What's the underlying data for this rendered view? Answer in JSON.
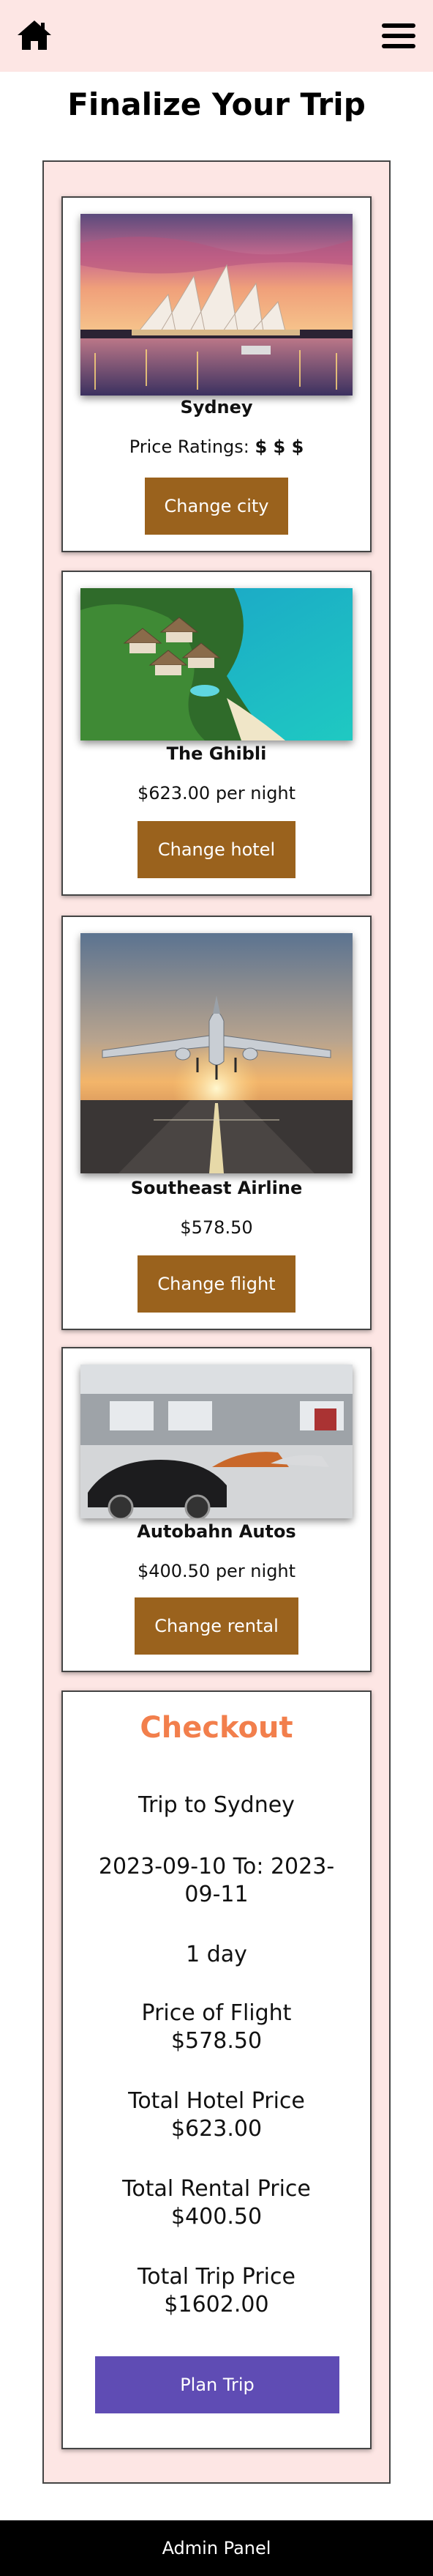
{
  "header": {
    "home_icon": "home-icon",
    "menu_icon": "hamburger-menu-icon"
  },
  "page_title": "Finalize Your Trip",
  "city": {
    "name": "Sydney",
    "price_label": "Price Ratings: ",
    "price_rating": "$ $ $",
    "button": "Change city"
  },
  "hotel": {
    "name": "The Ghibli",
    "price": "$623.00 per night",
    "button": "Change hotel"
  },
  "flight": {
    "name": "Southeast Airline",
    "price": "$578.50",
    "button": "Change flight"
  },
  "rental": {
    "name": "Autobahn Autos",
    "price": "$400.50 per night",
    "button": "Change rental"
  },
  "checkout": {
    "title": "Checkout",
    "trip": "Trip to Sydney",
    "dates_line1": "2023-09-10 To: 2023-",
    "dates_line2": "09-11",
    "duration": "1 day",
    "flight_label": "Price of Flight",
    "flight_value": "$578.50",
    "hotel_label": "Total Hotel Price",
    "hotel_value": "$623.00",
    "rental_label": "Total Rental Price",
    "rental_value": "$400.50",
    "total_label": "Total Trip Price",
    "total_value": "$1602.00",
    "button": "Plan Trip"
  },
  "footer": {
    "label": "Admin Panel"
  },
  "colors": {
    "header_bg": "#fde6e4",
    "brown_button": "#9a621d",
    "checkout_title": "#f27f4c",
    "plan_button": "#5f4cb4",
    "footer_bg": "#000000"
  }
}
